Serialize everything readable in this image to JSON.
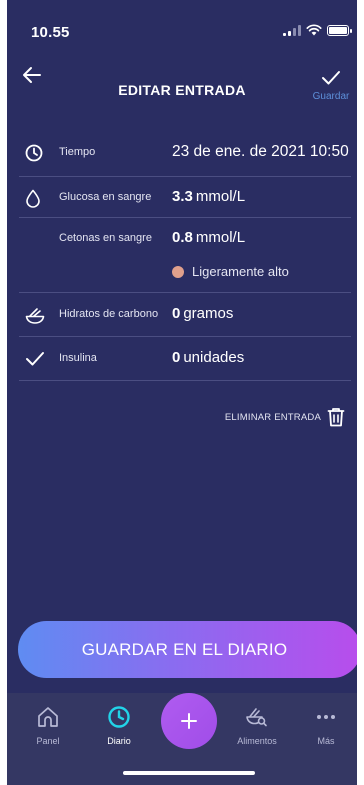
{
  "status": {
    "time": "10.55"
  },
  "header": {
    "title": "EDITAR ENTRADA",
    "save_label": "Guardar"
  },
  "rows": {
    "tiempo": {
      "label": "Tiempo",
      "value": "23 de ene. de 2021 10:50",
      "icon": "clock-icon"
    },
    "glucosa": {
      "label": "Glucosa en sangre",
      "number": "3.3",
      "unit": "mmol/L",
      "icon": "drop-icon"
    },
    "cetonas": {
      "label": "Cetonas en sangre",
      "number": "0.8",
      "unit": "mmol/L",
      "status": "Ligeramente alto",
      "status_color": "#e0a08c"
    },
    "hidratos": {
      "label": "Hidratos de carbono",
      "number": "0",
      "unit": "gramos",
      "icon": "bowl-icon"
    },
    "insulina": {
      "label": "Insulina",
      "number": "0",
      "unit": "unidades",
      "icon": "check-icon"
    }
  },
  "delete_label": "ELIMINAR ENTRADA",
  "save_button": "GUARDAR EN EL DIARIO",
  "tabs": [
    {
      "label": "Panel",
      "icon": "home-icon",
      "active": false
    },
    {
      "label": "Diario",
      "icon": "clock-icon",
      "active": true
    },
    {
      "label": "Alimentos",
      "icon": "food-search-icon",
      "active": false
    },
    {
      "label": "Más",
      "icon": "more-icon",
      "active": false
    }
  ],
  "colors": {
    "background": "#2a2d62",
    "accent": "#5d8fd9",
    "tab_active": "#22d3e8",
    "fab": "#a855f7"
  }
}
